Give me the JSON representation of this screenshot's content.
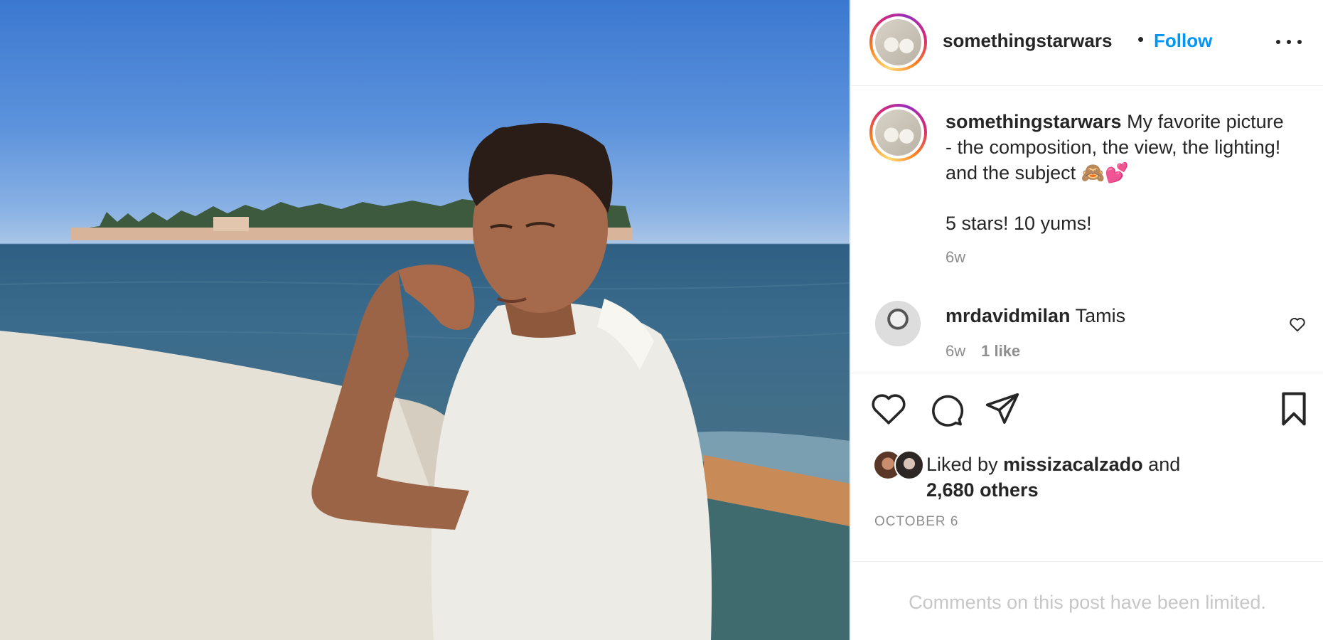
{
  "header": {
    "username": "somethingstarwars",
    "separator": "•",
    "follow_label": "Follow"
  },
  "caption": {
    "username": "somethingstarwars",
    "text": " My favorite picture - the composition, the view, the lighting! and the subject 🙈💕",
    "text_line2": "5 stars! 10 yums!",
    "time": "6w"
  },
  "comment": {
    "username": "mrdavidmilan",
    "text": "Tamis",
    "time": "6w",
    "likes": "1 like"
  },
  "actions": {
    "icons": [
      "heart-icon",
      "comment-icon",
      "share-icon",
      "bookmark-icon"
    ]
  },
  "likes": {
    "prefix": "Liked by ",
    "user": "missizacalzado",
    "and": " and ",
    "others": "2,680 others"
  },
  "date": "OCTOBER 6",
  "comments_limited": "Comments on this post have been limited.",
  "colors": {
    "follow": "#0095f6",
    "text": "#262626",
    "secondary": "#8e8e8e",
    "muted": "#c7c7c7"
  }
}
